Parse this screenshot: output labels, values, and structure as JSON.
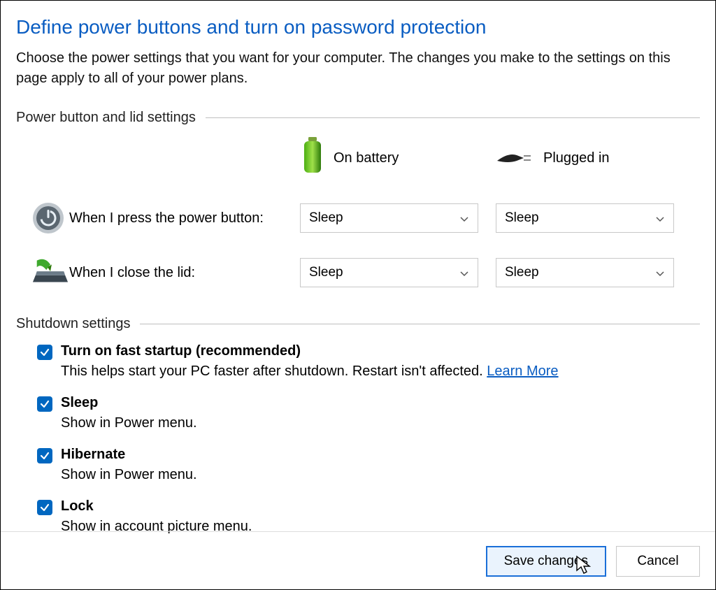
{
  "header": {
    "title": "Define power buttons and turn on password protection",
    "subtitle": "Choose the power settings that you want for your computer. The changes you make to the settings on this page apply to all of your power plans."
  },
  "sections": {
    "power_lid": {
      "label": "Power button and lid settings",
      "columns": {
        "battery": "On battery",
        "plugged": "Plugged in"
      },
      "rows": {
        "power_button": {
          "label": "When I press the power button:",
          "battery_value": "Sleep",
          "plugged_value": "Sleep"
        },
        "close_lid": {
          "label": "When I close the lid:",
          "battery_value": "Sleep",
          "plugged_value": "Sleep"
        }
      }
    },
    "shutdown": {
      "label": "Shutdown settings",
      "items": {
        "fast_startup": {
          "title": "Turn on fast startup (recommended)",
          "desc": "This helps start your PC faster after shutdown. Restart isn't affected. ",
          "link": "Learn More",
          "checked": true
        },
        "sleep": {
          "title": "Sleep",
          "desc": "Show in Power menu.",
          "checked": true
        },
        "hibernate": {
          "title": "Hibernate",
          "desc": "Show in Power menu.",
          "checked": true
        },
        "lock": {
          "title": "Lock",
          "desc": "Show in account picture menu.",
          "checked": true
        }
      }
    }
  },
  "buttons": {
    "save": "Save changes",
    "cancel": "Cancel"
  }
}
